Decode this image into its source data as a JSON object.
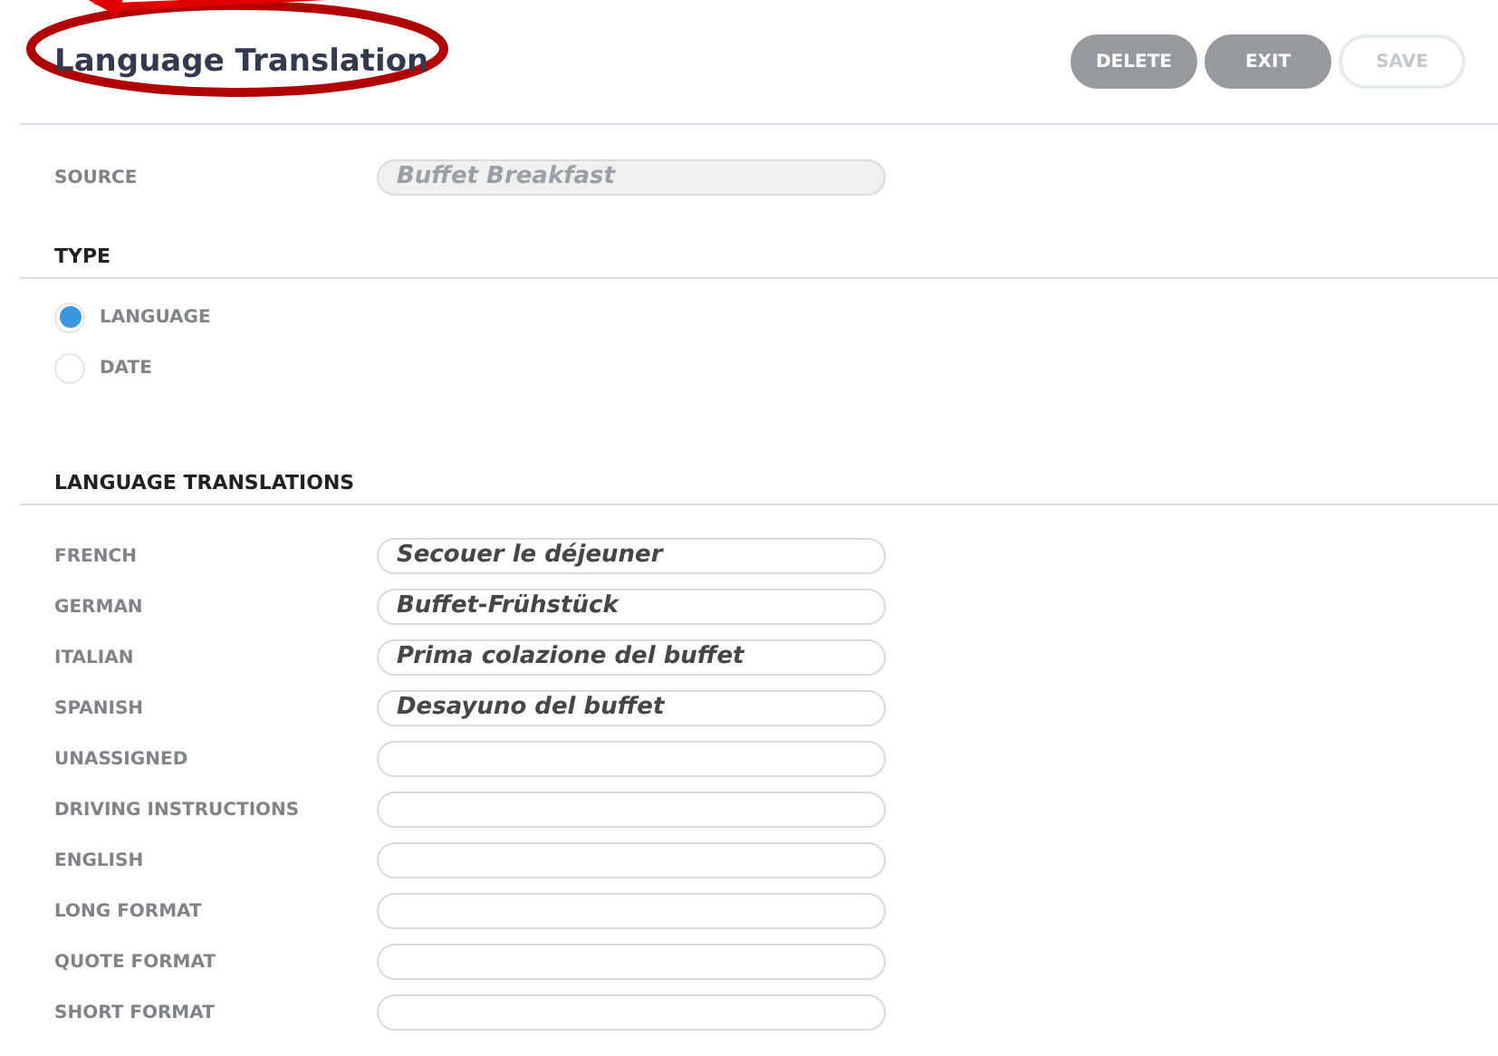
{
  "title": "Language Translation",
  "buttons": [
    {
      "label": "DELETE",
      "disabled": false
    },
    {
      "label": "EXIT",
      "disabled": false
    },
    {
      "label": "SAVE",
      "disabled": true
    }
  ],
  "source": {
    "label": "SOURCE",
    "value": "Buffet Breakfast",
    "disabled": true
  },
  "type": {
    "heading": "TYPE",
    "options": [
      {
        "label": "LANGUAGE",
        "selected": true
      },
      {
        "label": "DATE",
        "selected": false
      }
    ]
  },
  "translations": {
    "heading": "LANGUAGE TRANSLATIONS",
    "rows": [
      {
        "label": "FRENCH",
        "value": "Secouer le déjeuner"
      },
      {
        "label": "GERMAN",
        "value": "Buffet-Frühstück"
      },
      {
        "label": "ITALIAN",
        "value": "Prima colazione del buffet"
      },
      {
        "label": "SPANISH",
        "value": "Desayuno del buffet"
      },
      {
        "label": "UNASSIGNED"
      },
      {
        "label": "DRIVING INSTRUCTIONS"
      },
      {
        "label": "ENGLISH"
      },
      {
        "label": "LONG FORMAT"
      },
      {
        "label": "QUOTE FORMAT"
      },
      {
        "label": "SHORT FORMAT"
      }
    ]
  }
}
